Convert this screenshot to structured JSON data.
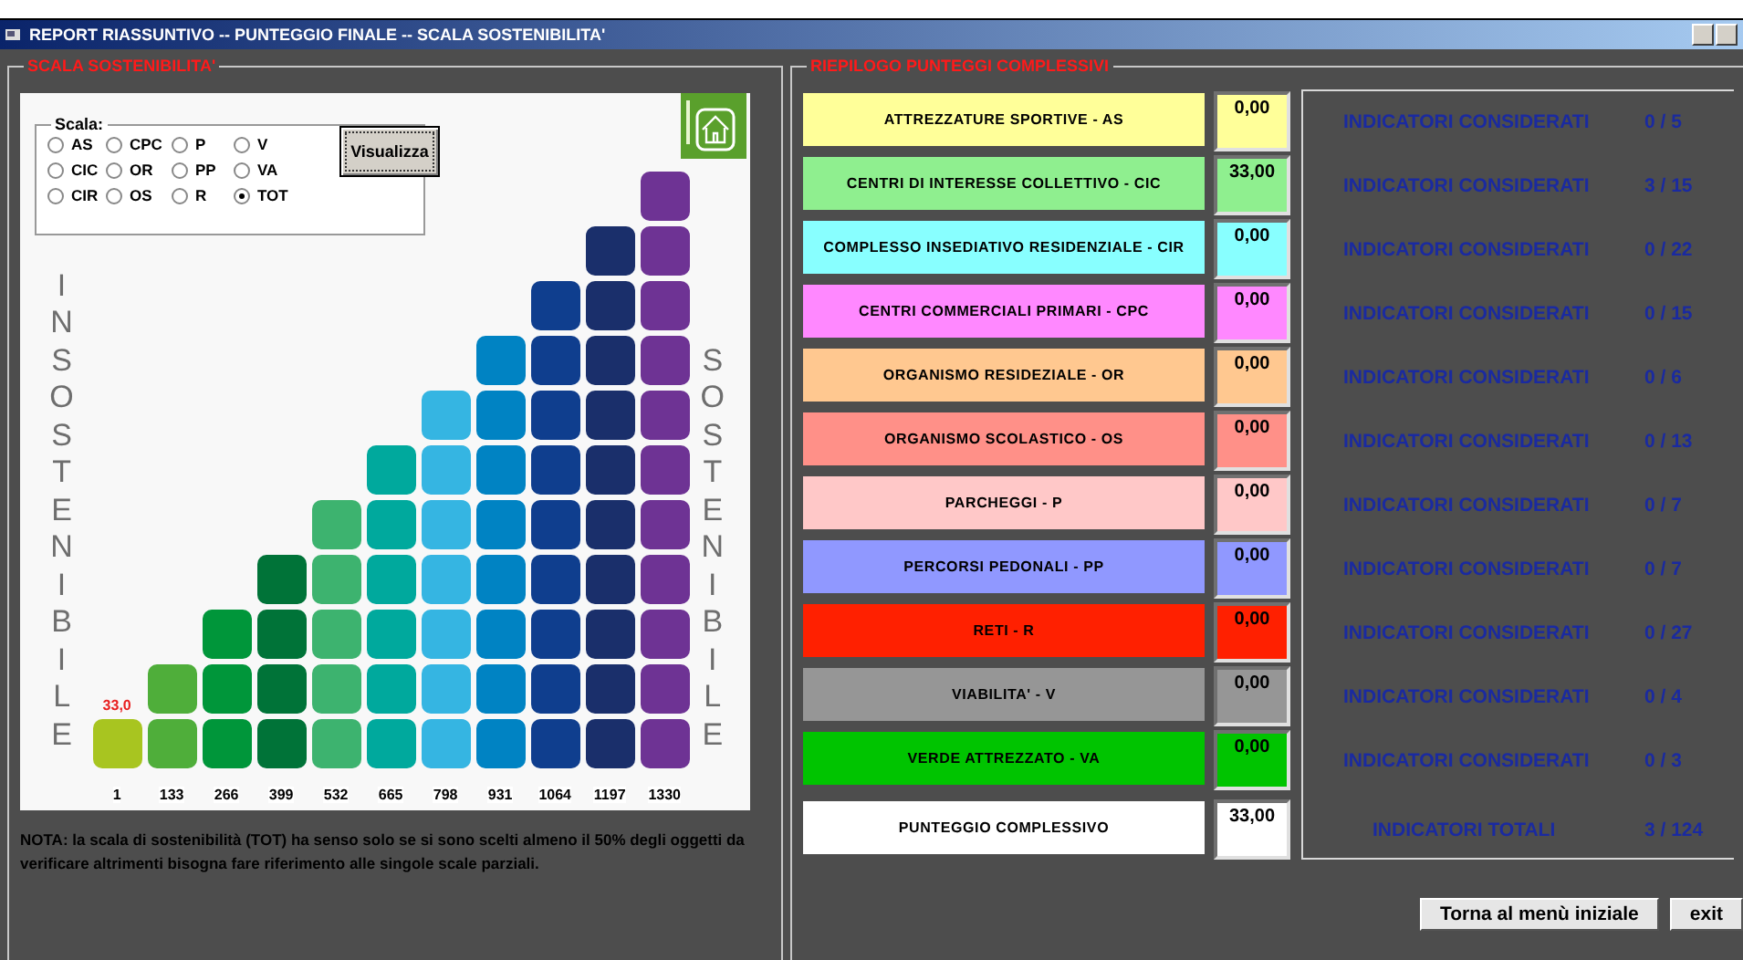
{
  "window": {
    "title": "REPORT RIASSUNTIVO -- PUNTEGGIO FINALE -- SCALA SOSTENIBILITA'"
  },
  "scale_panel": {
    "title": "SCALA SOSTENIBILITA'",
    "scale_group": {
      "title": "Scala:",
      "options": [
        {
          "label": "AS",
          "selected": false
        },
        {
          "label": "CPC",
          "selected": false
        },
        {
          "label": "P",
          "selected": false
        },
        {
          "label": "V",
          "selected": false
        },
        {
          "label": "CIC",
          "selected": false
        },
        {
          "label": "OR",
          "selected": false
        },
        {
          "label": "PP",
          "selected": false
        },
        {
          "label": "VA",
          "selected": false
        },
        {
          "label": "CIR",
          "selected": false
        },
        {
          "label": "OS",
          "selected": false
        },
        {
          "label": "R",
          "selected": false
        },
        {
          "label": "TOT",
          "selected": true
        }
      ],
      "button": "Visualizza"
    },
    "left_label": "INSOSTENIBILE",
    "right_label": "SOSTENIBILE",
    "columns": [
      {
        "label": "1",
        "color": "#a8c520",
        "marker": "33,0"
      },
      {
        "label": "133",
        "color": "#4fae3a"
      },
      {
        "label": "266",
        "color": "#00963a"
      },
      {
        "label": "399",
        "color": "#007338"
      },
      {
        "label": "532",
        "color": "#3db36f"
      },
      {
        "label": "665",
        "color": "#00a99d"
      },
      {
        "label": "798",
        "color": "#35b5e2"
      },
      {
        "label": "931",
        "color": "#0083c3"
      },
      {
        "label": "1064",
        "color": "#0f3e8e"
      },
      {
        "label": "1197",
        "color": "#1a2f6b"
      },
      {
        "label": "1330",
        "color": "#6e3394"
      }
    ],
    "note": "NOTA: la scala di sostenibilità (TOT) ha senso solo se si sono scelti almeno il 50% degli oggetti da verificare altrimenti bisogna fare riferimento alle singole scale parziali."
  },
  "summary_panel": {
    "title": "RIEPILOGO PUNTEGGI COMPLESSIVI",
    "categories": [
      {
        "label": "ATTREZZATURE SPORTIVE - AS",
        "score": "0,00",
        "color": "#ffff99",
        "indicators": "INDICATORI CONSIDERATI",
        "count": "0 / 5"
      },
      {
        "label": "CENTRI DI INTERESSE COLLETTIVO - CIC",
        "score": "33,00",
        "color": "#8fef8f",
        "indicators": "INDICATORI CONSIDERATI",
        "count": "3 / 15"
      },
      {
        "label": "COMPLESSO INSEDIATIVO RESIDENZIALE - CIR",
        "score": "0,00",
        "color": "#88ffff",
        "indicators": "INDICATORI CONSIDERATI",
        "count": "0 / 22"
      },
      {
        "label": "CENTRI COMMERCIALI PRIMARI - CPC",
        "score": "0,00",
        "color": "#ff88ff",
        "indicators": "INDICATORI CONSIDERATI",
        "count": "0 / 15"
      },
      {
        "label": "ORGANISMO RESIDEZIALE - OR",
        "score": "0,00",
        "color": "#ffc890",
        "indicators": "INDICATORI CONSIDERATI",
        "count": "0 / 6"
      },
      {
        "label": "ORGANISMO SCOLASTICO - OS",
        "score": "0,00",
        "color": "#ff9088",
        "indicators": "INDICATORI CONSIDERATI",
        "count": "0 / 13"
      },
      {
        "label": "PARCHEGGI - P",
        "score": "0,00",
        "color": "#ffc8c8",
        "indicators": "INDICATORI CONSIDERATI",
        "count": "0 / 7"
      },
      {
        "label": "PERCORSI PEDONALI - PP",
        "score": "0,00",
        "color": "#9098ff",
        "indicators": "INDICATORI CONSIDERATI",
        "count": "0 / 7"
      },
      {
        "label": "RETI - R",
        "score": "0,00",
        "color": "#ff2000",
        "indicators": "INDICATORI CONSIDERATI",
        "count": "0 / 27"
      },
      {
        "label": "VIABILITA' - V",
        "score": "0,00",
        "color": "#969696",
        "indicators": "INDICATORI CONSIDERATI",
        "count": "0 / 4"
      },
      {
        "label": "VERDE ATTREZZATO - VA",
        "score": "0,00",
        "color": "#00c400",
        "indicators": "INDICATORI CONSIDERATI",
        "count": "0 / 3"
      }
    ],
    "total": {
      "label": "PUNTEGGIO COMPLESSIVO",
      "score": "33,00",
      "indicators": "INDICATORI TOTALI",
      "count": "3 / 124"
    },
    "buttons": [
      "Torna al menù iniziale",
      "exit"
    ]
  }
}
